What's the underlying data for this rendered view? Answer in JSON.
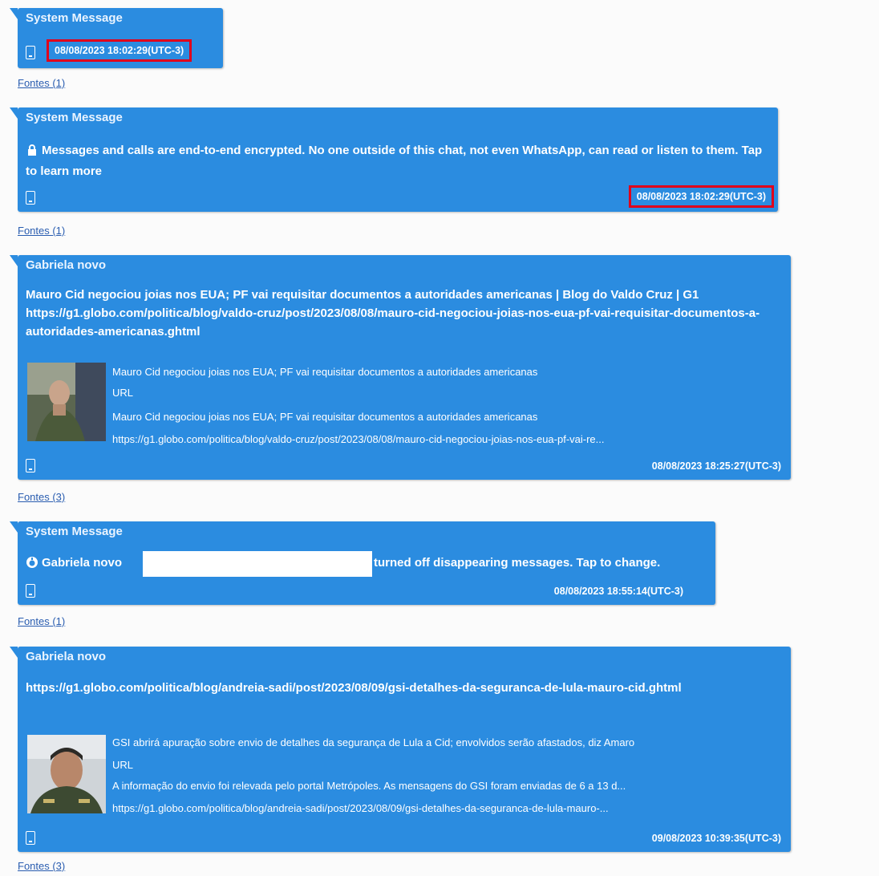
{
  "messages": [
    {
      "sender": "System Message",
      "timestamp": "08/08/2023 18:02:29(UTC-3)",
      "sources": "Fontes (1)"
    },
    {
      "sender": "System Message",
      "body": "Messages and calls are end-to-end encrypted. No one outside of this chat, not even WhatsApp, can read or listen to them. Tap to learn more",
      "timestamp": "08/08/2023 18:02:29(UTC-3)",
      "sources": "Fontes (1)"
    },
    {
      "sender": "Gabriela novo",
      "body": "Mauro Cid negociou joias nos EUA; PF vai requisitar documentos a autoridades americanas | Blog do Valdo Cruz | G1 https://g1.globo.com/politica/blog/valdo-cruz/post/2023/08/08/mauro-cid-negociou-joias-nos-eua-pf-vai-requisitar-documentos-a-autoridades-americanas.ghtml",
      "preview": {
        "title": "Mauro Cid negociou joias nos EUA; PF vai requisitar documentos a autoridades americanas",
        "type": "URL",
        "description": "Mauro Cid negociou joias nos EUA; PF vai requisitar documentos a autoridades americanas",
        "url": "https://g1.globo.com/politica/blog/valdo-cruz/post/2023/08/08/mauro-cid-negociou-joias-nos-eua-pf-vai-re..."
      },
      "timestamp": "08/08/2023 18:25:27(UTC-3)",
      "sources": "Fontes (3)"
    },
    {
      "sender": "System Message",
      "body_prefix": "Gabriela novo",
      "body_suffix": "turned off disappearing messages. Tap to change.",
      "timestamp": "08/08/2023 18:55:14(UTC-3)",
      "sources": "Fontes (1)"
    },
    {
      "sender": "Gabriela novo",
      "body": "https://g1.globo.com/politica/blog/andreia-sadi/post/2023/08/09/gsi-detalhes-da-seguranca-de-lula-mauro-cid.ghtml",
      "preview": {
        "title": "GSI abrirá apuração sobre envio de detalhes da segurança de Lula a Cid; envolvidos serão afastados, diz Amaro",
        "type": "URL",
        "description": "A informação do envio foi relevada pelo portal Metrópoles. As mensagens do GSI foram enviadas de 6 a 13 d...",
        "url": "https://g1.globo.com/politica/blog/andreia-sadi/post/2023/08/09/gsi-detalhes-da-seguranca-de-lula-mauro-..."
      },
      "timestamp": "09/08/2023 10:39:35(UTC-3)",
      "sources": "Fontes (3)"
    }
  ]
}
